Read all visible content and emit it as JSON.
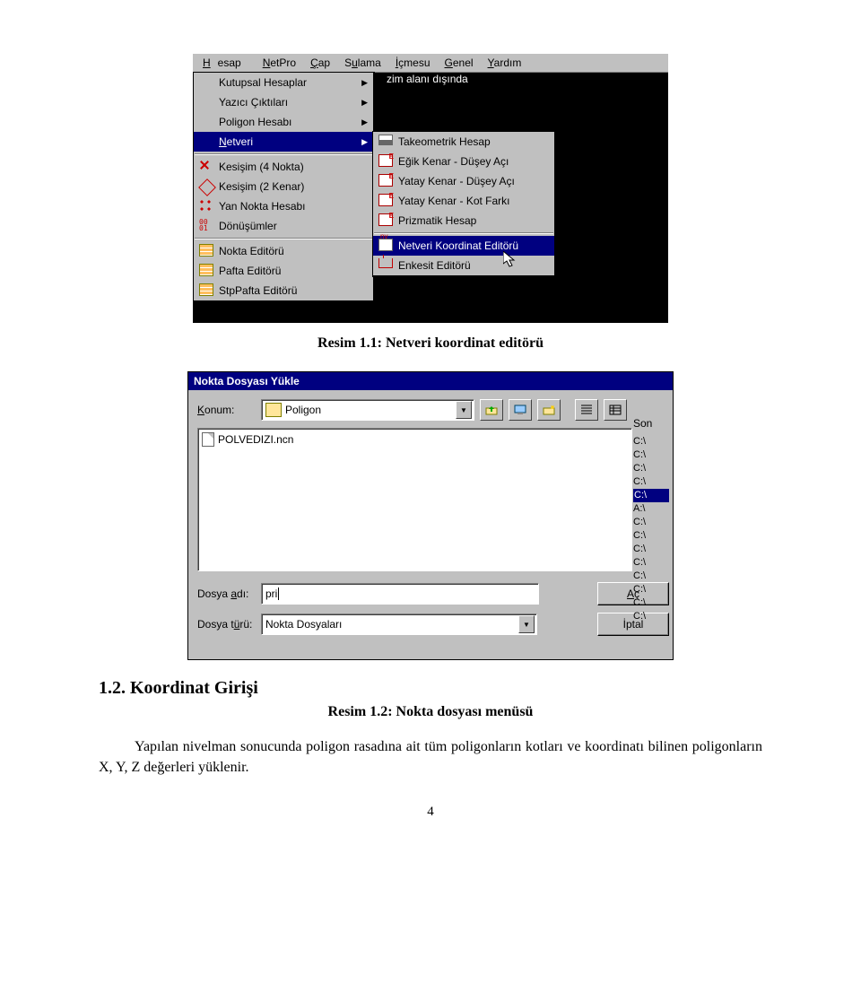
{
  "menubar": [
    "Hesap",
    "NetPro",
    "Çap",
    "Sulama",
    "İçmesu",
    "Genel",
    "Yardım"
  ],
  "status_text": "zim alanı dışında",
  "dropdown_items": [
    {
      "label": "Kutupsal Hesaplar",
      "arrow": true
    },
    {
      "label": "Yazıcı Çıktıları",
      "arrow": true
    },
    {
      "label": "Poligon Hesabı",
      "arrow": true
    },
    {
      "label": "Netveri",
      "arrow": true,
      "hl": true
    },
    {
      "label": "Kesişim (4 Nokta)"
    },
    {
      "label": "Kesişim (2 Kenar)"
    },
    {
      "label": "Yan Nokta Hesabı"
    },
    {
      "label": "Dönüşümler"
    },
    {
      "label": "Nokta Editörü"
    },
    {
      "label": "Pafta Editörü"
    },
    {
      "label": "StpPafta Editörü"
    }
  ],
  "submenu_items": [
    {
      "label": "Takeometrik Hesap"
    },
    {
      "label": "Eğik Kenar - Düşey Açı"
    },
    {
      "label": "Yatay Kenar - Düşey Açı"
    },
    {
      "label": "Yatay Kenar - Kot Farkı"
    },
    {
      "label": "Prizmatik Hesap"
    },
    {
      "label": "Netveri Koordinat Editörü",
      "hl": true
    },
    {
      "label": "Enkesit Editörü"
    }
  ],
  "caption1": "Resim 1.1: Netveri koordinat editörü",
  "dialog": {
    "title": "Nokta Dosyası Yükle",
    "konum_label": "Konum:",
    "konum_value": "Poligon",
    "file_listed": "POLVEDIZI.ncn",
    "dosya_adi_label": "Dosya adı:",
    "dosya_adi_value": "pri",
    "dosya_turu_label": "Dosya türü:",
    "dosya_turu_value": "Nokta Dosyaları",
    "btn_open": "Aç",
    "btn_cancel": "İptal",
    "side_header": "Son",
    "side_rows": [
      "C:\\",
      "C:\\",
      "C:\\",
      "C:\\",
      "C:\\",
      "A:\\",
      "C:\\",
      "C:\\",
      "C:\\",
      "C:\\",
      "C:\\",
      "C:\\",
      "C:\\",
      "C:\\"
    ]
  },
  "section_number": "1.2. Koordinat Girişi",
  "caption2": "Resim 1.2: Nokta dosyası menüsü",
  "paragraph": "Yapılan nivelman sonucunda poligon rasadına ait tüm poligonların kotları ve koordinatı bilinen poligonların X, Y, Z değerleri yüklenir.",
  "page_number": "4"
}
